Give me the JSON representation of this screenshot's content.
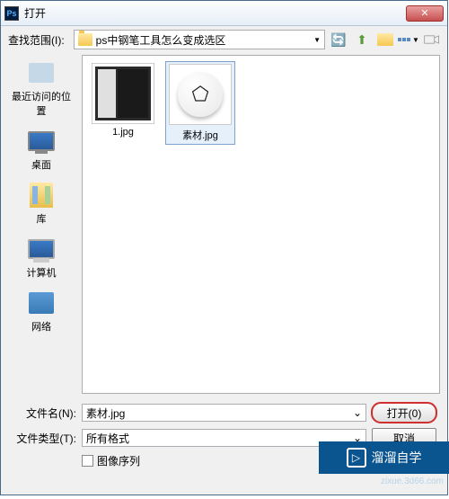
{
  "titlebar": {
    "icon_text": "Ps",
    "title": "打开",
    "close": "✕"
  },
  "toolbar": {
    "lookin_label": "查找范围(I):",
    "folder_name": "ps中钢笔工具怎么变成选区",
    "dropdown_arrow": "▼",
    "view_arrow": "▼"
  },
  "sidebar": {
    "items": [
      {
        "label": "最近访问的位置"
      },
      {
        "label": "桌面"
      },
      {
        "label": "库"
      },
      {
        "label": "计算机"
      },
      {
        "label": "网络"
      }
    ]
  },
  "files": {
    "items": [
      {
        "label": "1.jpg",
        "selected": false
      },
      {
        "label": "素材.jpg",
        "selected": true
      }
    ]
  },
  "fields": {
    "filename_label": "文件名(N):",
    "filename_value": "素材.jpg",
    "filetype_label": "文件类型(T):",
    "filetype_value": "所有格式",
    "dropdown_arrow": "⌄"
  },
  "buttons": {
    "open": "打开(0)",
    "cancel": "取消"
  },
  "checkbox": {
    "label": "图像序列"
  },
  "watermark": {
    "icon": "▷",
    "text": "溜溜自学",
    "sub": "zixue.3d66.com"
  }
}
